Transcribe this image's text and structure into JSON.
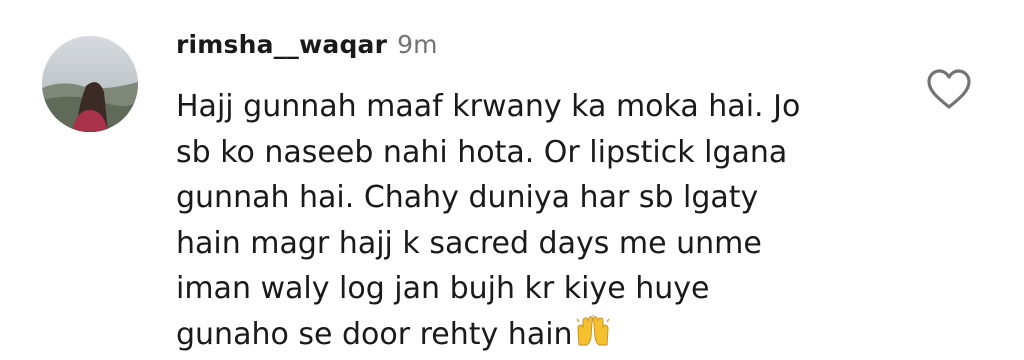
{
  "comment": {
    "username": "rimsha__waqar",
    "timestamp": "9m",
    "text_lines": [
      "Hajj gunnah maaf krwany ka moka hai. Jo",
      "sb ko naseeb nahi hota. Or lipstick lgana",
      "gunnah hai. Chahy duniya har sb lgaty",
      "hain magr hajj k sacred days me unme",
      "iman waly log jan bujh kr kiye huye",
      "gunaho se door rehty hain"
    ],
    "emoji": "raising-hands-emoji",
    "like_icon": "heart-outline-icon",
    "avatar": "profile-avatar"
  },
  "colors": {
    "text": "#1a1a1a",
    "muted": "#737373",
    "emoji_yellow": "#f5c12e"
  }
}
